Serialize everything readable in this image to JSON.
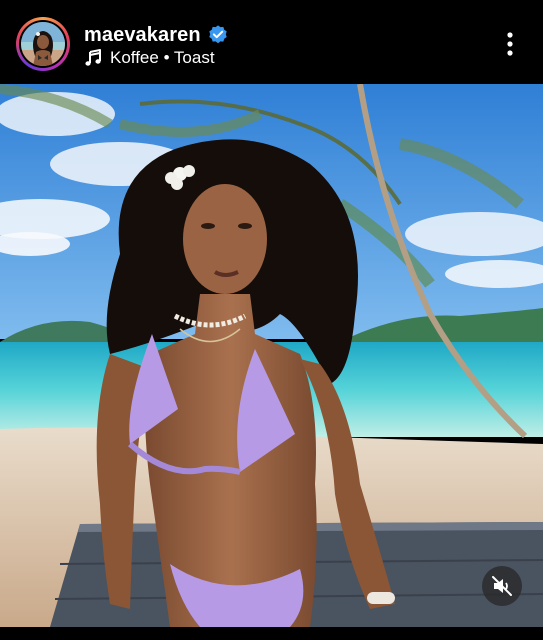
{
  "post": {
    "username": "maevakaren",
    "verified_icon": "verified-badge-icon",
    "audio": {
      "icon": "music-note-icon",
      "text": "Koffee • Toast"
    },
    "more_icon": "more-vertical-icon"
  },
  "media": {
    "type": "photo",
    "audio_state": "muted",
    "mute_icon": "speaker-muted-icon"
  },
  "colors": {
    "background": "#000000",
    "verified_blue": "#3897f0",
    "text": "#ffffff"
  }
}
